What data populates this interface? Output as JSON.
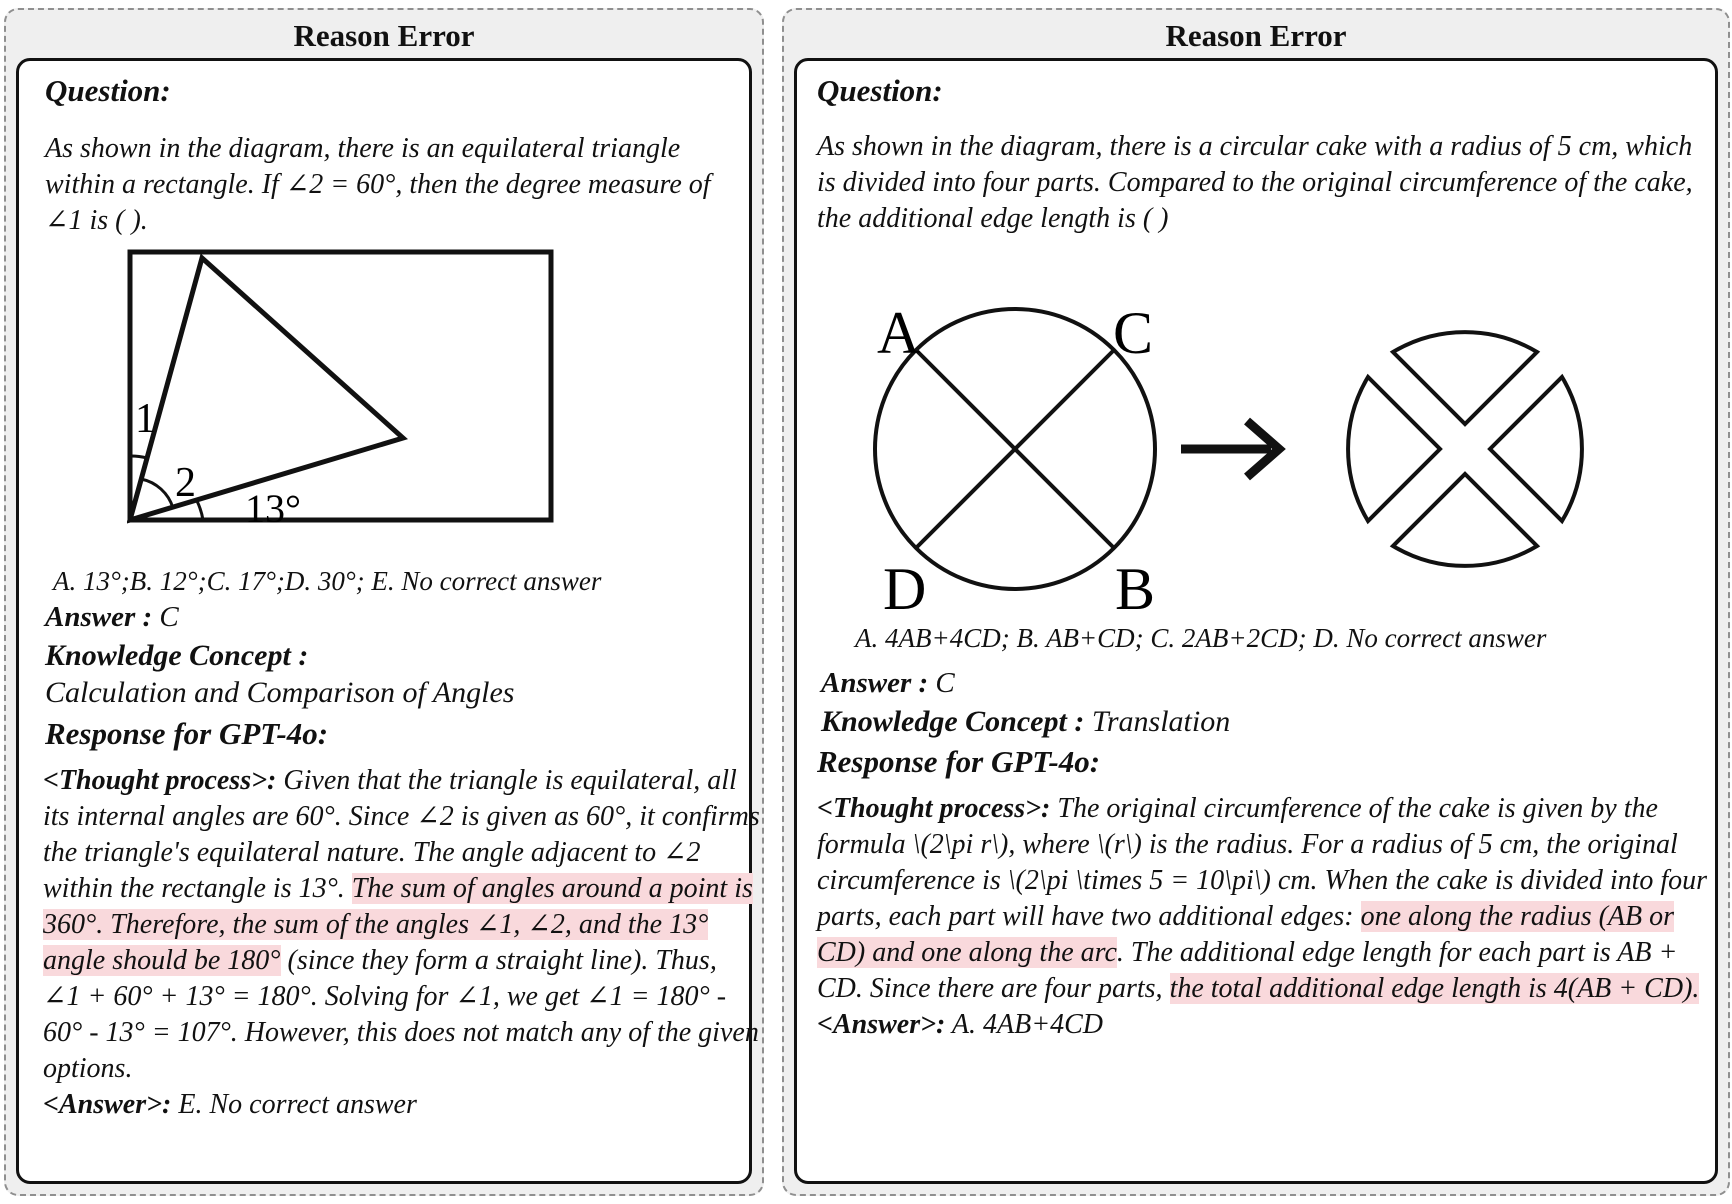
{
  "left": {
    "title": "Reason Error",
    "question_label": "Question:",
    "question_text": "As shown in the diagram, there is an equilateral triangle within a rectangle. If ∠2 = 60°, then the degree measure of ∠1 is (    ).",
    "diagram_labels": {
      "angle1": "1",
      "angle2": "2",
      "angle13": "13°"
    },
    "options": "A. 13°;B. 12°;C. 17°;D. 30°; E. No correct answer",
    "answer_label": "Answer :",
    "answer_value": " C",
    "kc_label": "Knowledge Concept :",
    "kc_value": "Calculation and Comparison of Angles",
    "response_label": "Response for GPT-4o:",
    "thought_tag": "<Thought process>:",
    "thought_1": " Given that the triangle is equilateral, all its internal angles are 60°. Since ∠2 is given as 60°, it confirms the triangle's equilateral nature. The angle adjacent to ∠2 within the rectangle is 13°. ",
    "thought_highlight": "The sum of angles around a point is 360°. Therefore, the sum of the angles ∠1, ∠2, and the 13° angle should be 180°",
    "thought_2": " (since they form a straight line). Thus, ∠1 + 60° + 13° = 180°. Solving for ∠1, we get ∠1 = 180° - 60° - 13° = 107°. However, this does not match any of the given options.",
    "answer_tag": "<Answer>:",
    "answer_text": " E. No correct answer"
  },
  "right": {
    "title": "Reason Error",
    "question_label": "Question:",
    "question_text": "As shown in the diagram, there is a circular cake with a radius of 5 cm, which is divided into four parts. Compared to the original circumference of the cake, the additional edge length is (    )",
    "diagram_labels": {
      "A": "A",
      "B": "B",
      "C": "C",
      "D": "D"
    },
    "options": "A. 4AB+4CD; B. AB+CD; C. 2AB+2CD; D. No correct answer",
    "answer_label": "Answer :",
    "answer_value": " C",
    "kc_label": "Knowledge Concept :",
    "kc_value": " Translation",
    "response_label": "Response for GPT-4o:",
    "thought_tag": "<Thought process>:",
    "thought_1": " The original circumference of the cake is given by the formula \\(2\\pi r\\), where \\(r\\) is the radius. For a radius of 5 cm, the original circumference is \\(2\\pi \\times 5 = 10\\pi\\) cm. When the cake is divided into four parts, each part will have two additional edges: ",
    "thought_highlight_1": "one along the radius (AB or CD) and one along the arc",
    "thought_2": ". The additional edge length for each part is AB + CD. Since there are four parts, ",
    "thought_highlight_2": "the total additional edge length is 4(AB + CD).",
    "answer_tag": "<Answer>:",
    "answer_text": " A. 4AB+4CD"
  }
}
